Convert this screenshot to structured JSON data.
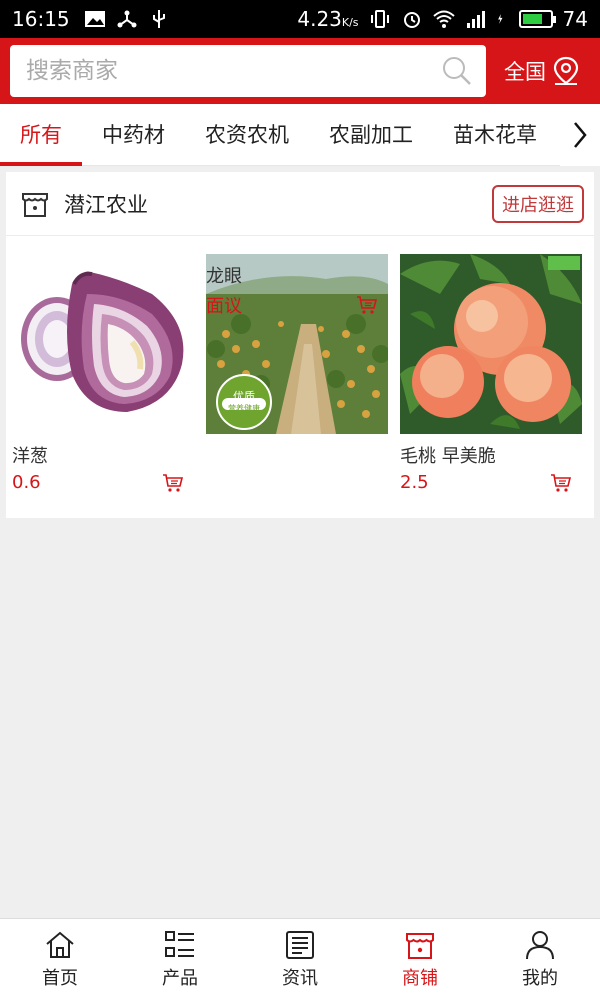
{
  "status_bar": {
    "time": "16:15",
    "speed": "4.23",
    "speed_unit": "K/s",
    "battery": "74",
    "battery_fraction": 0.74
  },
  "search": {
    "placeholder": "搜索商家",
    "icon": "search-icon"
  },
  "region": {
    "label": "全国",
    "icon": "location-pin-icon"
  },
  "tabs": [
    {
      "label": "所有",
      "active": true
    },
    {
      "label": "中药材",
      "active": false
    },
    {
      "label": "农资农机",
      "active": false
    },
    {
      "label": "农副加工",
      "active": false
    },
    {
      "label": "苗木花草",
      "active": false
    }
  ],
  "shop": {
    "name": "潜江农业",
    "visit_label": "进店逛逛",
    "products": [
      {
        "name": "洋葱",
        "price": "0.6",
        "image": "onion"
      },
      {
        "name": "龙眼",
        "price": "面议",
        "image": "longan-orchard",
        "badge_top": "优质",
        "badge_bottom": "营养健康"
      },
      {
        "name": "毛桃 早美脆",
        "price": "2.5",
        "image": "peaches"
      }
    ]
  },
  "bottom_nav": [
    {
      "label": "首页",
      "icon": "home-icon",
      "active": false
    },
    {
      "label": "产品",
      "icon": "list-icon",
      "active": false
    },
    {
      "label": "资讯",
      "icon": "news-icon",
      "active": false
    },
    {
      "label": "商铺",
      "icon": "store-icon",
      "active": true
    },
    {
      "label": "我的",
      "icon": "user-icon",
      "active": false
    }
  ],
  "colors": {
    "brand": "#d61518",
    "background": "#efefef"
  }
}
